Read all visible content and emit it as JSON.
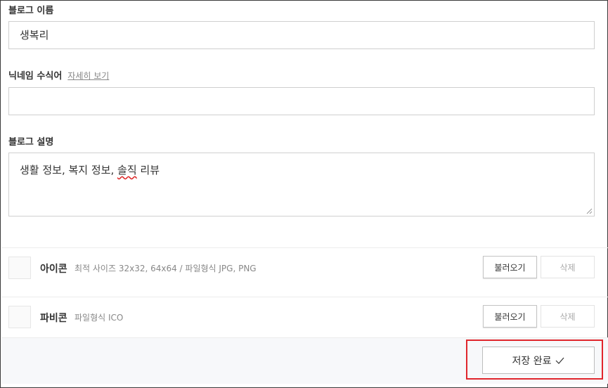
{
  "blog_name": {
    "label": "블로그 이름",
    "value": "생복리"
  },
  "nickname_suffix": {
    "label": "닉네임 수식어",
    "help_link": "자세히 보기",
    "value": ""
  },
  "blog_description": {
    "label": "블로그 설명",
    "value_before": "생활 정보, 복지 정보, ",
    "value_misspelled": "솔직",
    "value_after": " 리뷰"
  },
  "icon_row": {
    "title": "아이콘",
    "description": "최적 사이즈 32x32, 64x64 / 파일형식 JPG, PNG",
    "load_label": "불러오기",
    "delete_label": "삭제"
  },
  "favicon_row": {
    "title": "파비콘",
    "description": "파일형식 ICO",
    "load_label": "불러오기",
    "delete_label": "삭제"
  },
  "footer": {
    "save_label": "저장 완료",
    "save_icon": "check-icon"
  },
  "colors": {
    "highlight": "#e0262c",
    "footer_bg": "#f7f8fa",
    "border": "#cfcfcf"
  }
}
